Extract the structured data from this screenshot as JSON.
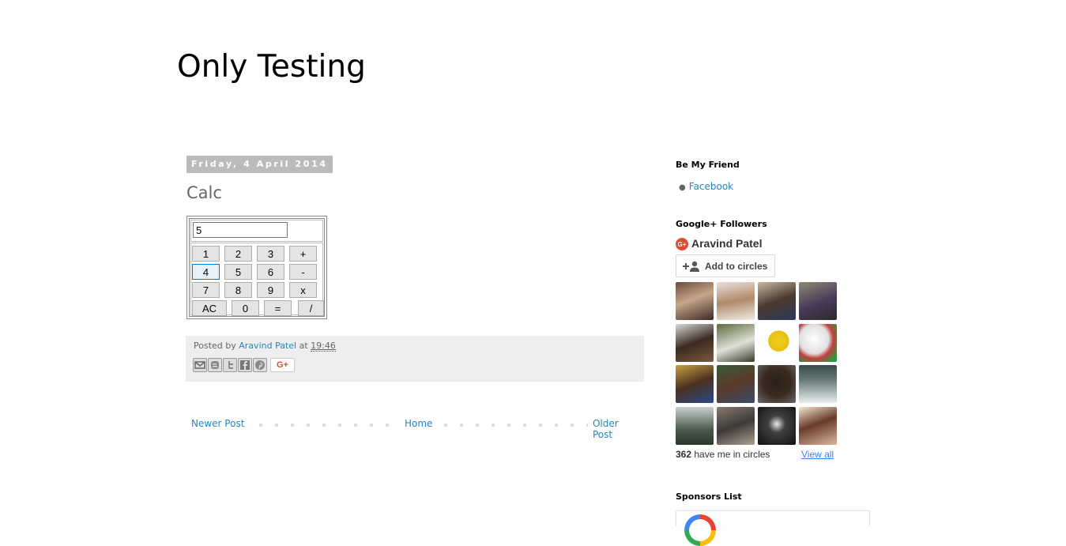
{
  "blog": {
    "title": "Only Testing"
  },
  "post": {
    "date": "Friday, 4 April 2014",
    "title": "Calc",
    "calculator": {
      "display_value": "5",
      "focused_key": "4",
      "rows": [
        [
          "1",
          "2",
          "3",
          "+"
        ],
        [
          "4",
          "5",
          "6",
          "-"
        ],
        [
          "7",
          "8",
          "9",
          "x"
        ],
        [
          "AC",
          "0",
          "=",
          "/"
        ]
      ]
    },
    "footer": {
      "posted_by_prefix": "Posted by",
      "author": "Aravind Patel",
      "at_word": "at",
      "time": "19:46",
      "share_buttons": [
        "email-icon",
        "blogger-icon",
        "twitter-icon",
        "facebook-icon",
        "pinterest-icon"
      ],
      "gplus_share_label": "G+"
    }
  },
  "pager": {
    "newer": "Newer Post",
    "home": "Home",
    "older": "Older Post"
  },
  "sidebar": {
    "friend_widget": {
      "title": "Be My Friend",
      "items": [
        "Facebook"
      ]
    },
    "gplus_widget": {
      "title": "Google+ Followers",
      "icon_label": "G+",
      "name": "Aravind Patel",
      "add_label": "Add to circles",
      "follower_count": "362",
      "count_suffix": "have me in circles",
      "view_all": "View all",
      "follower_avatars": 16
    },
    "sponsors_widget": {
      "title": "Sponsors List"
    }
  },
  "colors": {
    "link": "#2288bb",
    "date_bg": "#bbbbbb",
    "footer_bg": "#eeeeee",
    "gplus_red": "#dd4b39",
    "view_all": "#427fed"
  }
}
